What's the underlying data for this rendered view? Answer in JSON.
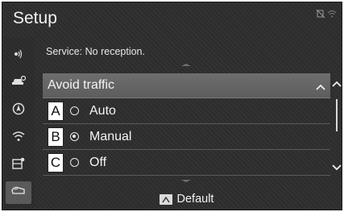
{
  "screen": {
    "title": "Setup"
  },
  "status_icons": [
    "no-signal-icon",
    "wifi-off-icon"
  ],
  "sidebar": {
    "items": [
      {
        "icon": "voice-icon"
      },
      {
        "icon": "car-settings-icon"
      },
      {
        "icon": "navigation-icon"
      },
      {
        "icon": "wifi-icon"
      },
      {
        "icon": "phone-settings-icon"
      },
      {
        "icon": "vehicle-icon",
        "active": true
      }
    ]
  },
  "service_status": "Service: No reception.",
  "section": {
    "label": "Avoid traffic",
    "expanded": true
  },
  "options": [
    {
      "marker": "A",
      "label": "Auto",
      "selected": false
    },
    {
      "marker": "B",
      "label": "Manual",
      "selected": true
    },
    {
      "marker": "C",
      "label": "Off",
      "selected": false
    }
  ],
  "footer": {
    "default_label": "Default",
    "icon": "default-icon"
  }
}
